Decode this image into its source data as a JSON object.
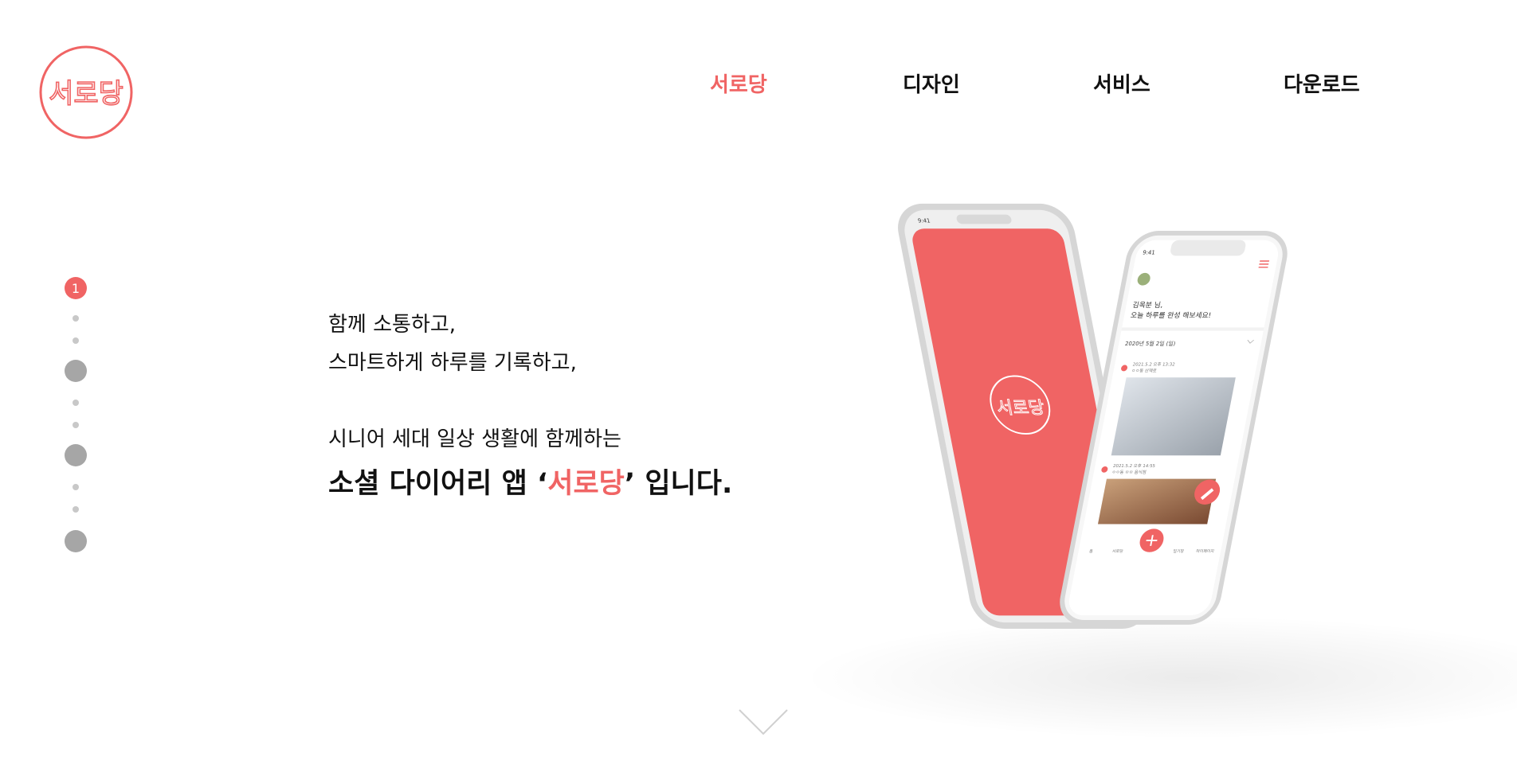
{
  "brand": {
    "logo_text": "서로당",
    "accent": "#f06464"
  },
  "nav": {
    "items": [
      "서로당",
      "디자인",
      "서비스",
      "다운로드"
    ]
  },
  "pager": {
    "active_label": "1"
  },
  "hero": {
    "line1": "함께 소통하고,",
    "line2": "스마트하게 하루를 기록하고,",
    "line3": "시니어 세대 일상 생활에 함께하는",
    "headline_pre": "소셜 다이어리 앱 ‘",
    "headline_accent": "서로당",
    "headline_post": "’ 입니다."
  },
  "phone_front": {
    "time": "9:41",
    "greeting_line1": "김옥분 님,",
    "greeting_line2": "오늘 하루를 완성 해보세요!",
    "date_header": "2020년 5월 2일 (일)",
    "entries": [
      {
        "time": "2021.5.2 오후 13:32",
        "place": "ㅇㅇ동 산책로"
      },
      {
        "time": "2021.5.2 오후 14:55",
        "place": "ㅇㅇ동 ㅁㅁ 음식점"
      }
    ],
    "tabs": [
      "홈",
      "서로당",
      "일기장",
      "마이페이지"
    ]
  },
  "phone_back": {
    "time": "9:41",
    "logo_text": "서로당"
  },
  "icons": {
    "menu": "hamburger-icon",
    "edit": "pencil-icon",
    "add": "plus-icon",
    "scroll": "chevron-down-icon",
    "location": "map-pin-icon"
  }
}
